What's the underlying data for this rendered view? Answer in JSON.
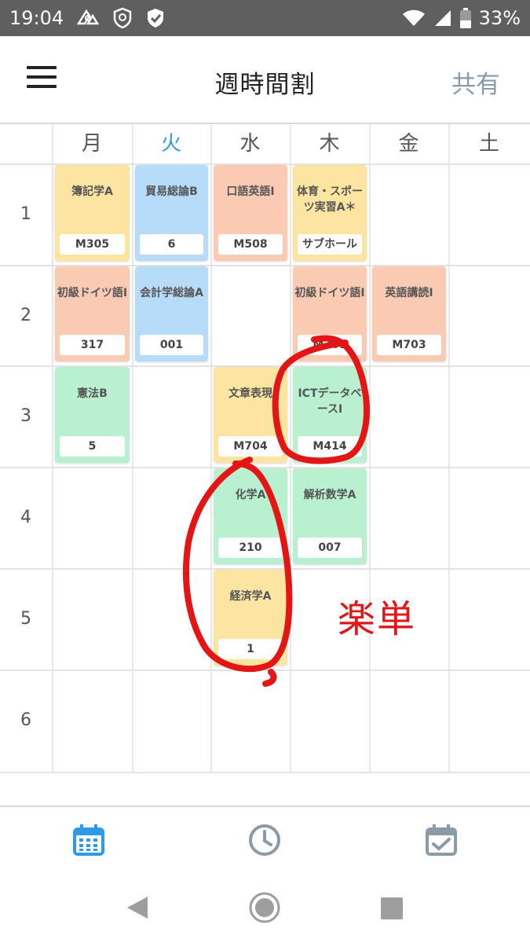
{
  "status_bar": {
    "time": "19:04",
    "battery": "33%",
    "icons": [
      "app-notification-icon",
      "vpn-shield-icon",
      "security-check-icon",
      "wifi-icon",
      "signal-icon",
      "battery-icon"
    ]
  },
  "header": {
    "title": "週時間割",
    "share_label": "共有",
    "menu_icon": "hamburger-menu-icon"
  },
  "days": [
    {
      "label": "月",
      "today": false
    },
    {
      "label": "火",
      "today": true
    },
    {
      "label": "水",
      "today": false
    },
    {
      "label": "木",
      "today": false
    },
    {
      "label": "金",
      "today": false
    },
    {
      "label": "土",
      "today": false
    }
  ],
  "periods": [
    "1",
    "2",
    "3",
    "4",
    "5",
    "6"
  ],
  "classes": {
    "p1": {
      "mon": {
        "name": "簿記学A",
        "room": "M305"
      },
      "tue": {
        "name": "貿易総論B",
        "room": "6"
      },
      "wed": {
        "name": "口語英語Ⅰ",
        "room": "M508"
      },
      "thu": {
        "name": "体育・スポーツ実習A＊",
        "room": "サブホール"
      }
    },
    "p2": {
      "mon": {
        "name": "初級ドイツ語Ⅰ",
        "room": "317"
      },
      "tue": {
        "name": "会計学総論A",
        "room": "001"
      },
      "thu": {
        "name": "初級ドイツ語Ⅰ",
        "room": "M301"
      },
      "fri": {
        "name": "英語講読Ⅰ",
        "room": "M703"
      }
    },
    "p3": {
      "mon": {
        "name": "憲法B",
        "room": "5"
      },
      "wed": {
        "name": "文章表現",
        "room": "M704"
      },
      "thu": {
        "name": "ICTデータベースⅠ",
        "room": "M414"
      }
    },
    "p4": {
      "wed": {
        "name": "化学A",
        "room": "210"
      },
      "thu": {
        "name": "解析数学A",
        "room": "007"
      }
    },
    "p5": {
      "wed": {
        "name": "経済学A",
        "room": "1"
      }
    }
  },
  "annotation": {
    "text": "楽単",
    "color": "#e31515"
  },
  "colors": {
    "today": "#2f9be8",
    "yellow": "#fce5a1",
    "blue": "#b7dcfa",
    "orange": "#fbcab3",
    "green": "#b9f0d0",
    "tab_active": "#2f9be8",
    "tab_inactive": "#8a9aa6"
  },
  "tabs": [
    {
      "icon": "calendar-icon",
      "active": true
    },
    {
      "icon": "clock-icon",
      "active": false
    },
    {
      "icon": "calendar-check-icon",
      "active": false
    }
  ],
  "nav_buttons": [
    "back-icon",
    "home-icon",
    "recents-icon"
  ]
}
